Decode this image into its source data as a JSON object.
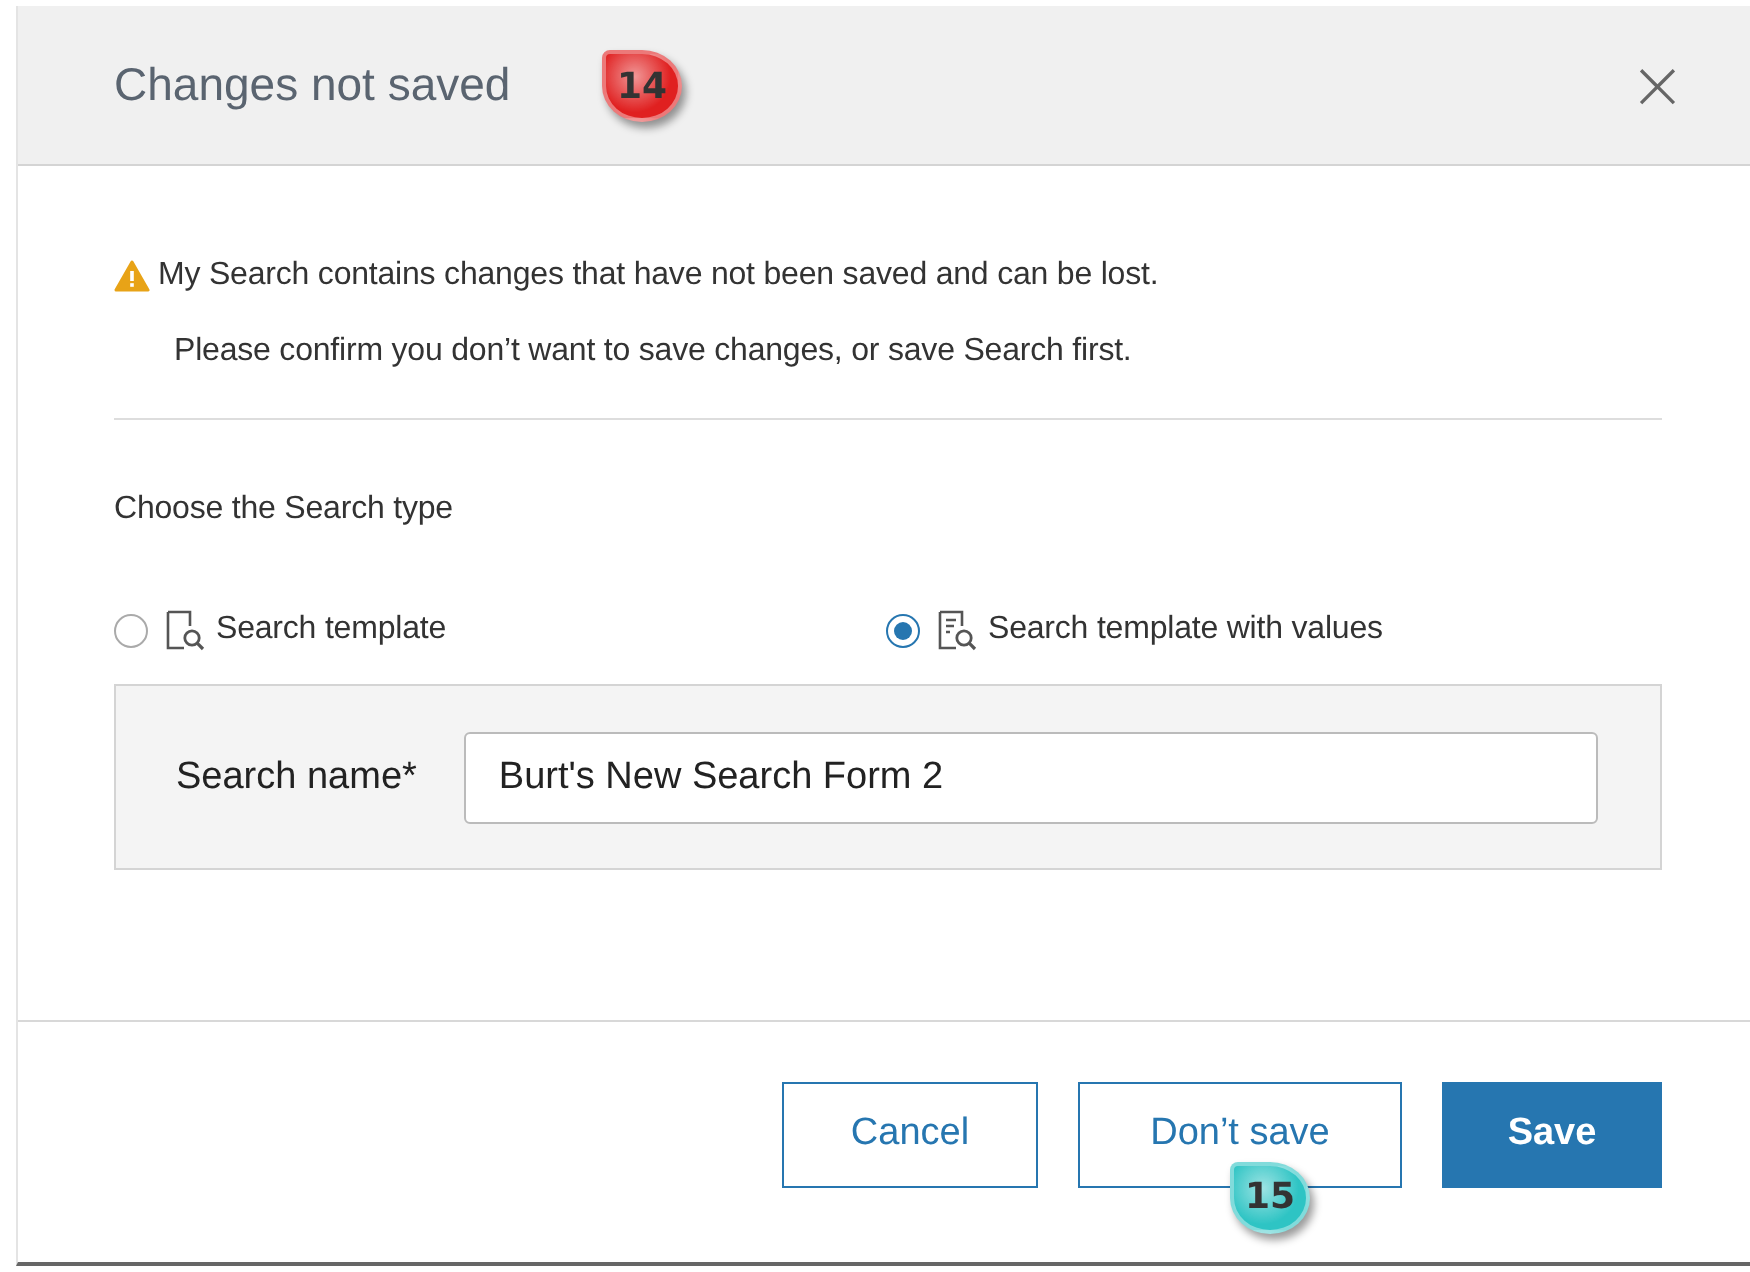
{
  "dialog": {
    "title": "Changes not saved",
    "close": "×",
    "callout": {
      "label": "14",
      "color": "#e02020"
    }
  },
  "warning": {
    "message": "My Search contains changes that have not been saved and can be lost.",
    "detail": "Please confirm you don’t want to save changes, or save Search first."
  },
  "search_type": {
    "label": "Choose the Search type",
    "options": [
      {
        "label": "Search template",
        "selected": false,
        "kind": "template"
      },
      {
        "label": "Search template with values",
        "selected": true,
        "kind": "values"
      }
    ]
  },
  "search_name": {
    "label": "Search name*",
    "value": "Burt's New Search Form 2"
  },
  "buttons": [
    {
      "label": "Cancel",
      "kind": "secondary"
    },
    {
      "label": "Don’t save",
      "kind": "secondary",
      "callout": {
        "label": "15",
        "color": "#2ec4c4"
      }
    },
    {
      "label": "Save",
      "kind": "primary"
    }
  ]
}
